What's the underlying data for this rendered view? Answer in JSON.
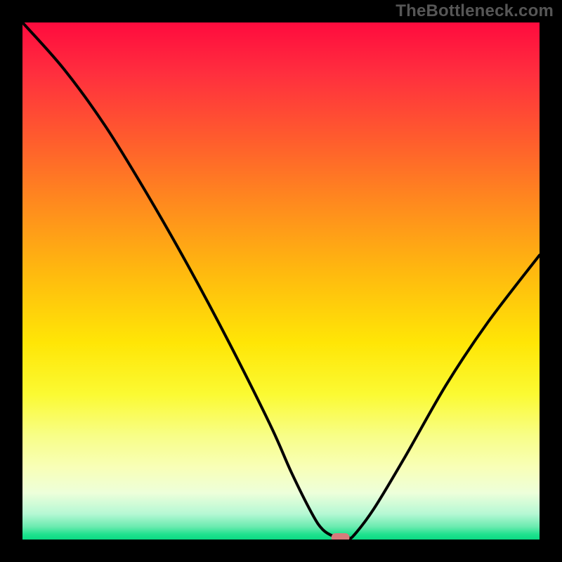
{
  "watermark": "TheBottleneck.com",
  "chart_data": {
    "type": "line",
    "title": "",
    "xlabel": "",
    "ylabel": "",
    "xlim": [
      0,
      100
    ],
    "ylim": [
      0,
      100
    ],
    "series": [
      {
        "name": "bottleneck-curve",
        "x": [
          0,
          8,
          16,
          24,
          32,
          40,
          48,
          52,
          56,
          58,
          60,
          62,
          63,
          64,
          68,
          74,
          82,
          90,
          100
        ],
        "values": [
          100,
          91,
          80,
          67,
          53,
          38,
          22,
          13,
          5,
          2,
          0.7,
          0.4,
          0.4,
          0.7,
          6,
          16,
          30,
          42,
          55
        ]
      }
    ],
    "optimum_marker": {
      "x": 61.5,
      "y": 0.4
    },
    "background_gradient": {
      "top": "#ff0b3e",
      "mid": "#ffe606",
      "bottom": "#0bdb84"
    }
  }
}
